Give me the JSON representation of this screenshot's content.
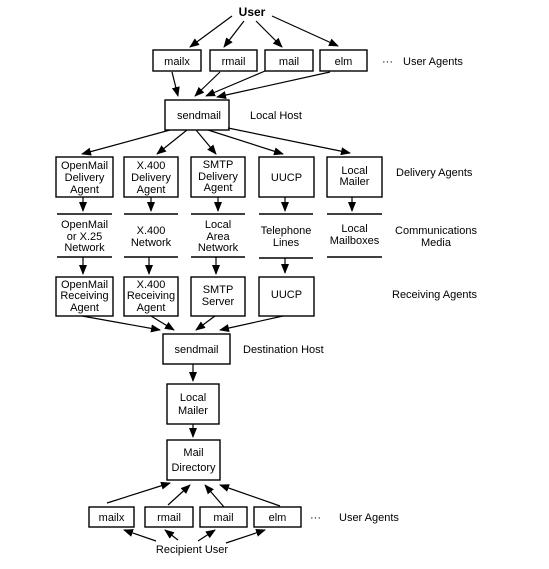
{
  "diagram": {
    "top_user": "User",
    "user_agents_top": [
      "mailx",
      "rmail",
      "mail",
      "elm"
    ],
    "ellipsis": "···",
    "labels": {
      "user_agents": "User Agents",
      "local_host": "Local Host",
      "delivery_agents": "Delivery Agents",
      "communications_media": [
        "Communications",
        "Media"
      ],
      "receiving_agents": "Receiving Agents",
      "destination_host": "Destination Host",
      "user_agents_bottom": "User Agents"
    },
    "sendmail_local": "sendmail",
    "delivery_agents": [
      [
        "OpenMail",
        "Delivery",
        "Agent"
      ],
      [
        "X.400",
        "Delivery",
        "Agent"
      ],
      [
        "SMTP",
        "Delivery",
        "Agent"
      ],
      [
        "UUCP"
      ],
      [
        "Local",
        "Mailer"
      ]
    ],
    "media": [
      [
        "OpenMail",
        "or X.25",
        "Network"
      ],
      [
        "X.400",
        "Network"
      ],
      [
        "Local",
        "Area",
        "Network"
      ],
      [
        "Telephone",
        "Lines"
      ],
      [
        "Local",
        "Mailboxes"
      ]
    ],
    "receiving_agents": [
      [
        "OpenMail",
        "Receiving",
        "Agent"
      ],
      [
        "X.400",
        "Receiving",
        "Agent"
      ],
      [
        "SMTP",
        "Server"
      ],
      [
        "UUCP"
      ]
    ],
    "sendmail_dest": "sendmail",
    "local_mailer": [
      "Local",
      "Mailer"
    ],
    "mail_directory": [
      "Mail",
      "Directory"
    ],
    "user_agents_bottom": [
      "mailx",
      "rmail",
      "mail",
      "elm"
    ],
    "recipient_user": "Recipient User"
  }
}
